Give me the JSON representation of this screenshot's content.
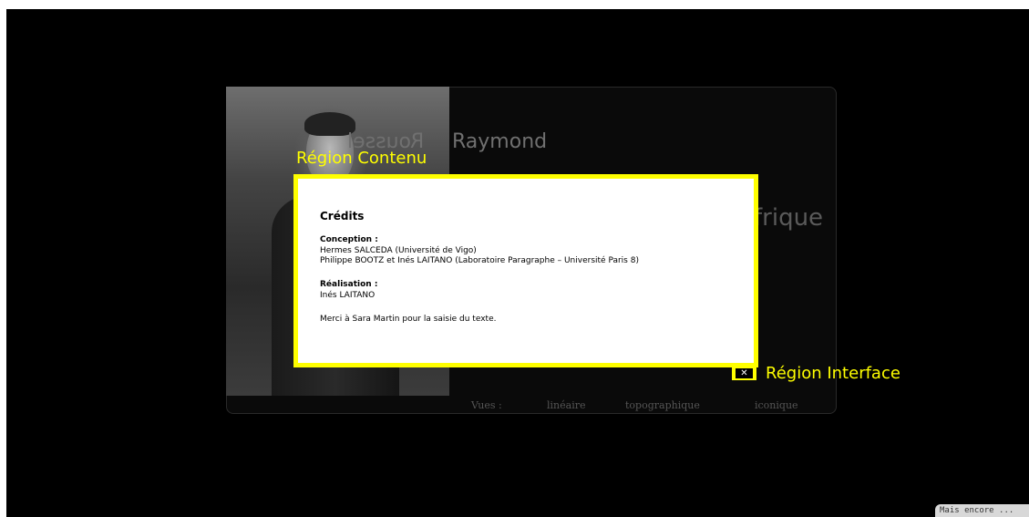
{
  "background_page": {
    "title_mirrored": "Roussel",
    "title_main": "Raymond",
    "partial_word": "frique",
    "views": {
      "label": "Vues :",
      "items": [
        "linéaire",
        "topographique",
        "iconique"
      ]
    }
  },
  "annotations": {
    "content_region_label": "Région Contenu",
    "interface_region_label": "Région Interface",
    "highlight_color": "#ffff00"
  },
  "credits": {
    "heading": "Crédits",
    "conception_label": "Conception :",
    "conception_lines": [
      "Hermes SALCEDA (Université de Vigo)",
      "Philippe BOOTZ et Inés LAITANO (Laboratoire Paragraphe – Université Paris 8)"
    ],
    "realisation_label": "Réalisation :",
    "realisation_lines": [
      "Inés LAITANO"
    ],
    "thanks": "Merci à Sara Martin pour la saisie du texte."
  },
  "close_button": {
    "icon": "close-icon",
    "glyph": "✕"
  },
  "more_link": {
    "label": "Mais encore ..."
  }
}
